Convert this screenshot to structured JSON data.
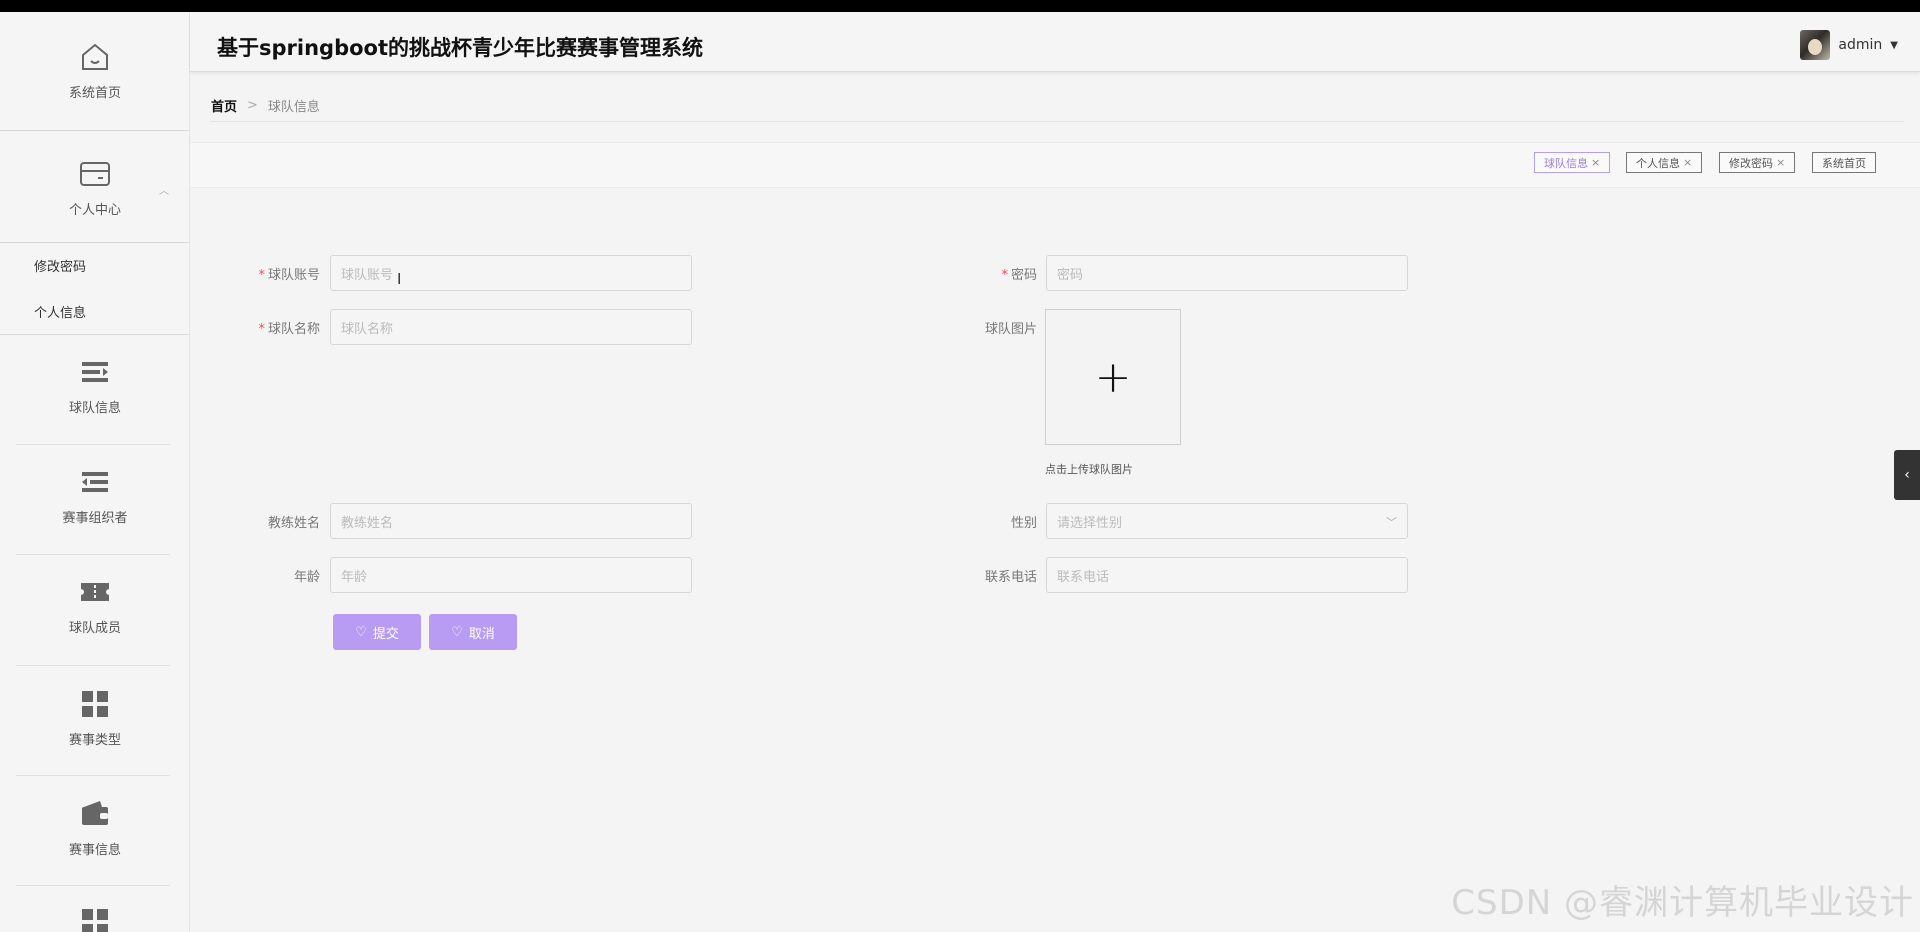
{
  "app": {
    "title": "基于springboot的挑战杯青少年比赛赛事管理系统"
  },
  "user": {
    "name": "admin"
  },
  "sidebar": {
    "home": "系统首页",
    "personal_center": "个人中心",
    "sub_items": [
      "修改密码",
      "个人信息"
    ],
    "items": [
      "球队信息",
      "赛事组织者",
      "球队成员",
      "赛事类型",
      "赛事信息"
    ]
  },
  "breadcrumb": {
    "home": "首页",
    "separator": ">",
    "current": "球队信息"
  },
  "tags": [
    "球队信息",
    "个人信息",
    "修改密码",
    "系统首页"
  ],
  "form": {
    "team_account": {
      "label": "球队账号",
      "placeholder": "球队账号",
      "required": true
    },
    "password": {
      "label": "密码",
      "placeholder": "密码",
      "required": true
    },
    "team_name": {
      "label": "球队名称",
      "placeholder": "球队名称",
      "required": true
    },
    "team_image": {
      "label": "球队图片",
      "tip": "点击上传球队图片"
    },
    "coach_name": {
      "label": "教练姓名",
      "placeholder": "教练姓名"
    },
    "gender": {
      "label": "性别",
      "placeholder": "请选择性别"
    },
    "age": {
      "label": "年龄",
      "placeholder": "年龄"
    },
    "phone": {
      "label": "联系电话",
      "placeholder": "联系电话"
    },
    "submit": "提交",
    "cancel": "取消"
  },
  "watermark": "CSDN @睿渊计算机毕业设计",
  "colors": {
    "accent": "#b89bf3",
    "required": "#e25555"
  }
}
